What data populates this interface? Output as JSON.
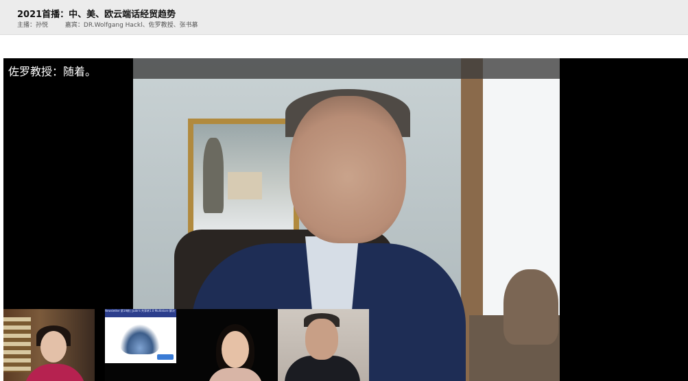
{
  "header": {
    "title": "2021首播：中、美、欧云端话经贸趋势",
    "host": "主播：孙悦",
    "guests": "嘉宾：DR.Wolfgang Hackl、佐罗教授、张书慕"
  },
  "main_video": {
    "caption": "佐罗教授：随着。"
  },
  "thumbnails": [
    {
      "name": "participant-1"
    },
    {
      "name": "participant-2",
      "slide_title": "Newsletter 第19期 | Jude's 共享转1.0 Multistore 解决"
    },
    {
      "name": "participant-3"
    }
  ]
}
